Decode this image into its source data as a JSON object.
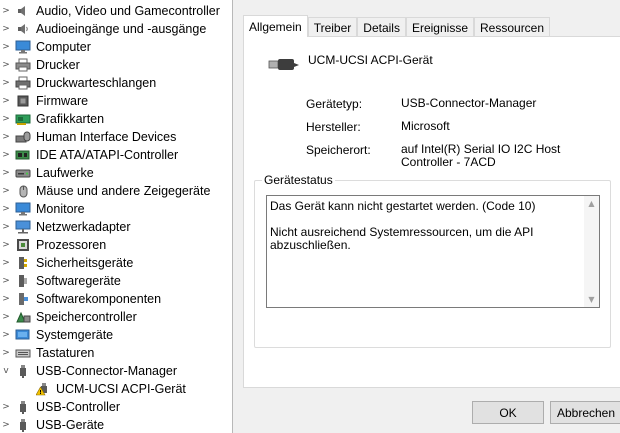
{
  "tree": {
    "items": [
      {
        "label": "Audio, Video und Gamecontroller",
        "icon": "speaker-icon",
        "expander": ">"
      },
      {
        "label": "Audioeingänge und -ausgänge",
        "icon": "speaker-icon",
        "expander": ">"
      },
      {
        "label": "Computer",
        "icon": "computer-icon",
        "expander": ">"
      },
      {
        "label": "Drucker",
        "icon": "printer-icon",
        "expander": ">"
      },
      {
        "label": "Druckwarteschlangen",
        "icon": "printer-icon",
        "expander": ">"
      },
      {
        "label": "Firmware",
        "icon": "chip-icon",
        "expander": ">"
      },
      {
        "label": "Grafikkarten",
        "icon": "display-adapter-icon",
        "expander": ">"
      },
      {
        "label": "Human Interface Devices",
        "icon": "hid-icon",
        "expander": ">"
      },
      {
        "label": "IDE ATA/ATAPI-Controller",
        "icon": "ide-controller-icon",
        "expander": ">"
      },
      {
        "label": "Laufwerke",
        "icon": "drive-icon",
        "expander": ">"
      },
      {
        "label": "Mäuse und andere Zeigegeräte",
        "icon": "mouse-icon",
        "expander": ">"
      },
      {
        "label": "Monitore",
        "icon": "monitor-icon",
        "expander": ">"
      },
      {
        "label": "Netzwerkadapter",
        "icon": "network-icon",
        "expander": ">"
      },
      {
        "label": "Prozessoren",
        "icon": "processor-icon",
        "expander": ">"
      },
      {
        "label": "Sicherheitsgeräte",
        "icon": "security-key-icon",
        "expander": ">"
      },
      {
        "label": "Softwaregeräte",
        "icon": "software-device-icon",
        "expander": ">"
      },
      {
        "label": "Softwarekomponenten",
        "icon": "software-component-icon",
        "expander": ">"
      },
      {
        "label": "Speichercontroller",
        "icon": "storage-controller-icon",
        "expander": ">"
      },
      {
        "label": "Systemgeräte",
        "icon": "system-device-icon",
        "expander": ">"
      },
      {
        "label": "Tastaturen",
        "icon": "keyboard-icon",
        "expander": ">"
      },
      {
        "label": "USB-Connector-Manager",
        "icon": "usb-icon",
        "expander": "v"
      },
      {
        "label": "UCM-UCSI ACPI-Gerät",
        "icon": "warning-usb-icon",
        "expander": "",
        "child": true
      },
      {
        "label": "USB-Controller",
        "icon": "usb-icon",
        "expander": ">"
      },
      {
        "label": "USB-Geräte",
        "icon": "usb-icon",
        "expander": ">"
      }
    ]
  },
  "dialog": {
    "tabs": [
      {
        "label": "Allgemein",
        "active": true
      },
      {
        "label": "Treiber",
        "active": false
      },
      {
        "label": "Details",
        "active": false
      },
      {
        "label": "Ereignisse",
        "active": false
      },
      {
        "label": "Ressourcen",
        "active": false
      }
    ],
    "device_name": "UCM-UCSI ACPI-Gerät",
    "device_icon": "usb-plug-icon",
    "properties": {
      "type_label": "Gerätetyp:",
      "type_value": "USB-Connector-Manager",
      "manufacturer_label": "Hersteller:",
      "manufacturer_value": "Microsoft",
      "location_label": "Speicherort:",
      "location_value": "auf Intel(R) Serial IO I2C Host Controller - 7ACD"
    },
    "status": {
      "group_title": "Gerätestatus",
      "line1": "Das Gerät kann nicht gestartet werden. (Code 10)",
      "line2": "Nicht ausreichend Systemressourcen, um die API abzuschließen."
    },
    "buttons": {
      "ok": "OK",
      "cancel": "Abbrechen"
    }
  },
  "colors": {
    "dialog_bg": "#f0f0f0",
    "warning": "#f2c200",
    "usb_gray": "#5a5a5a"
  }
}
